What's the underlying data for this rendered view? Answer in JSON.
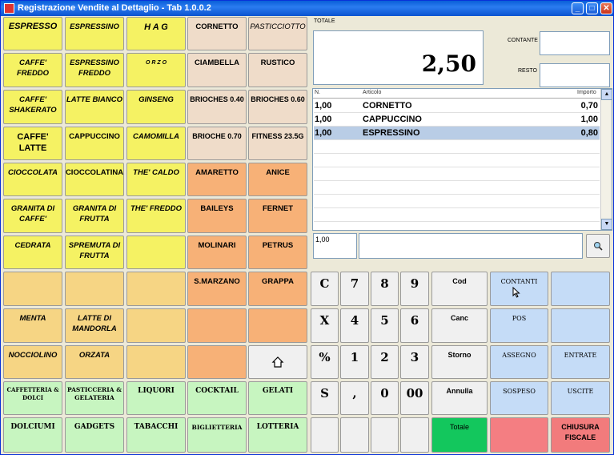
{
  "window": {
    "title": "Registrazione Vendite al Dettaglio - Tab 1.0.0.2"
  },
  "products": {
    "espresso": "ESPRESSO",
    "espressino": "ESPRESSINO",
    "hag": "H A G",
    "cornetto": "CORNETTO",
    "pasticciotto": "PASTICCIOTTO",
    "caffe_freddo": "CAFFE' FREDDO",
    "espressino_freddo": "ESPRESSINO FREDDO",
    "orzo": "O R Z O",
    "ciambella": "CIAMBELLA",
    "rustico": "RUSTICO",
    "caffe_shakerato": "CAFFE' SHAKERATO",
    "latte_bianco": "LATTE BIANCO",
    "ginseng": "GINSENG",
    "brioches_040": "BRIOCHES 0.40",
    "brioches_060": "BRIOCHES 0.60",
    "caffe_latte": "CAFFE' LATTE",
    "cappuccino": "CAPPUCCINO",
    "camomilla": "CAMOMILLA",
    "brioche_070": "BRIOCHE 0.70",
    "fitness": "FITNESS 23.5G",
    "cioccolata": "CIOCCOLATA",
    "cioccolatina": "CIOCCOLATINA",
    "the_caldo": "THE' CALDO",
    "amaretto": "AMARETTO",
    "anice": "ANICE",
    "granita_caffe": "GRANITA DI CAFFE'",
    "granita_frutta": "GRANITA DI FRUTTA",
    "the_freddo": "THE' FREDDO",
    "baileys": "BAILEYS",
    "fernet": "FERNET",
    "cedrata": "CEDRATA",
    "spremuta": "SPREMUTA DI FRUTTA",
    "molinari": "MOLINARI",
    "petrus": "PETRUS",
    "smarzano": "S.MARZANO",
    "grappa": "GRAPPA",
    "menta": "MENTA",
    "latte_mandorla": "LATTE DI MANDORLA",
    "nocciolino": "NOCCIOLINO",
    "orzata": "ORZATA"
  },
  "categories": {
    "caffetteria": "CAFFETTERIA & DOLCI",
    "pasticceria": "PASTICCERIA & GELATERIA",
    "liquori": "LIQUORI",
    "cocktail": "COCKTAIL",
    "gelati": "GELATI",
    "dolciumi": "DOLCIUMI",
    "gadgets": "GADGETS",
    "tabacchi": "TABACCHI",
    "biglietteria": "BIGLIETTERIA",
    "lotteria": "LOTTERIA"
  },
  "totals": {
    "label": "TOTALE",
    "value": "2,50",
    "contante_label": "CONTANTE",
    "contante_value": "",
    "resto_label": "RESTO",
    "resto_value": ""
  },
  "receipt": {
    "headers": {
      "qty": "N.",
      "article": "Articolo",
      "amount": "Importo"
    },
    "rows": [
      {
        "qty": "1,00",
        "article": "CORNETTO",
        "amount": "0,70"
      },
      {
        "qty": "1,00",
        "article": "CAPPUCCINO",
        "amount": "1,00"
      },
      {
        "qty": "1,00",
        "article": "ESPRESSINO",
        "amount": "0,80"
      }
    ]
  },
  "entry": {
    "qty": "1,00",
    "code": ""
  },
  "keypad": {
    "c": "C",
    "x": "X",
    "pct": "%",
    "s": "S",
    "k7": "7",
    "k8": "8",
    "k9": "9",
    "k4": "4",
    "k5": "5",
    "k6": "6",
    "k1": "1",
    "k2": "2",
    "k3": "3",
    "comma": ",",
    "k0": "0",
    "k00": "00"
  },
  "functions": {
    "cod": "Cod",
    "canc": "Canc",
    "storno": "Storno",
    "annulla": "Annulla",
    "totale": "Totale",
    "contanti": "CONTANTI",
    "pos": "POS",
    "assegno": "ASSEGNO",
    "sospeso": "SOSPESO",
    "entrate": "ENTRATE",
    "uscite": "USCITE",
    "chiusura": "CHIUSURA FISCALE"
  },
  "colors": {
    "yellow": "#f5f263",
    "beige": "#efdcc9",
    "orange": "#f7b177",
    "green": "#c7f5c0",
    "blue": "#c5dcf7",
    "total_green": "#13c75d",
    "red": "#f27b7c"
  },
  "icons": {
    "home": "home-icon",
    "search": "search-icon"
  }
}
